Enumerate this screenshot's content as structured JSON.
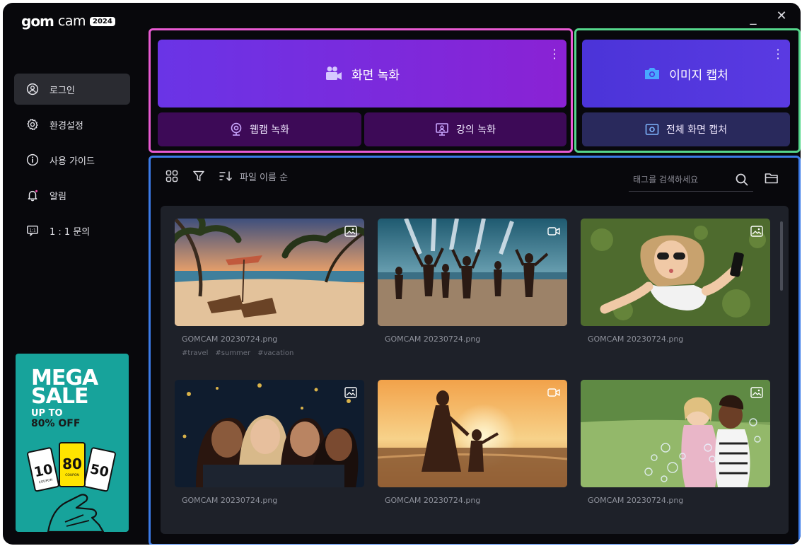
{
  "app": {
    "logo_mark": "gom",
    "logo_cam": "cam",
    "logo_year": "2024"
  },
  "window": {
    "minimize": "_",
    "close": "✕"
  },
  "sidebar": {
    "items": [
      {
        "label": "로그인",
        "icon": "user-circle-icon",
        "active": true
      },
      {
        "label": "환경설정",
        "icon": "gear-icon"
      },
      {
        "label": "사용 가이드",
        "icon": "info-icon"
      },
      {
        "label": "알림",
        "icon": "bell-icon"
      },
      {
        "label": "1 : 1 문의",
        "icon": "chat-icon"
      }
    ]
  },
  "promo": {
    "line1": "MEGA",
    "line2": "SALE",
    "line3": "UP TO",
    "line4": "80% OFF",
    "coupon_left": "10",
    "coupon_mid": "80",
    "coupon_right": "50",
    "coupon_word": "COUPON"
  },
  "record": {
    "main_label": "화면 녹화",
    "webcam_label": "웹캠 녹화",
    "lecture_label": "강의 녹화"
  },
  "capture": {
    "main_label": "이미지 캡처",
    "full_label": "전체 화면 캡처"
  },
  "gallery": {
    "sort_label": "파일 이름 순",
    "search_placeholder": "태그를 검색하세요",
    "cards": [
      {
        "name": "GOMCAM 20230724.png",
        "type": "image",
        "scene": "beach",
        "tags": [
          "#travel",
          "#summer",
          "#vacation"
        ]
      },
      {
        "name": "GOMCAM 20230724.png",
        "type": "video",
        "scene": "party-beach",
        "tags": []
      },
      {
        "name": "GOMCAM 20230724.png",
        "type": "image",
        "scene": "grass-girl",
        "tags": []
      },
      {
        "name": "GOMCAM 20230724.png",
        "type": "image",
        "scene": "selfie",
        "tags": []
      },
      {
        "name": "GOMCAM 20230724.png",
        "type": "video",
        "scene": "sunset",
        "tags": []
      },
      {
        "name": "GOMCAM 20230724.png",
        "type": "image",
        "scene": "bubbles",
        "tags": []
      }
    ]
  },
  "colors": {
    "accent_purple": "#7a2ee0",
    "panel_pink": "#e85ad2",
    "panel_green": "#55d68b",
    "panel_blue": "#3b7be8",
    "promo_teal": "#17a39b"
  }
}
